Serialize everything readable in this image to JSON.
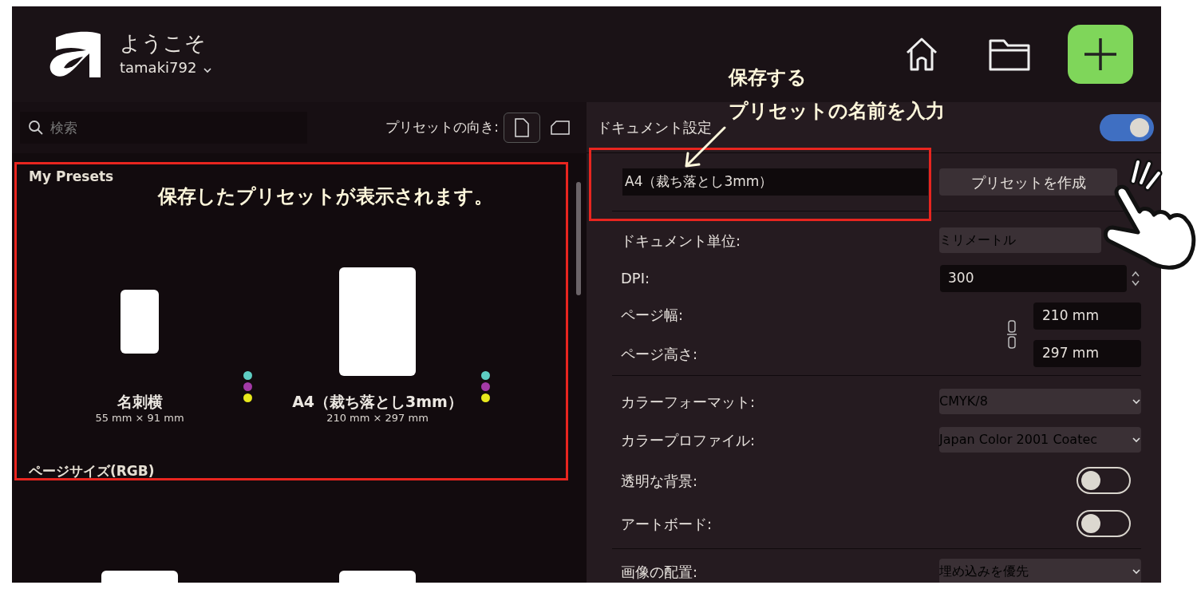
{
  "header": {
    "greeting": "ようこそ",
    "username": "tamaki792"
  },
  "left_panel": {
    "search": {
      "placeholder": "検索"
    },
    "orientation_label": "プリセットの向き:",
    "orientation_buttons": [
      {
        "kind": "portrait",
        "selected": true
      },
      {
        "kind": "landscape",
        "selected": false
      }
    ],
    "sections": [
      {
        "title": "My Presets",
        "presets": [
          {
            "kind": "small",
            "name": "名刺横",
            "size": "55 mm × 91 mm",
            "inks": [
              {
                "color": "#5ecdc2"
              },
              {
                "color": "#a33aa6"
              },
              {
                "color": "#e8e81c"
              }
            ]
          },
          {
            "kind": "large",
            "name": "A4（裁ち落とし3mm）",
            "size": "210 mm × 297 mm",
            "inks": [
              {
                "color": "#5ecdc2"
              },
              {
                "color": "#a33aa6"
              },
              {
                "color": "#e8e81c"
              }
            ]
          }
        ]
      },
      {
        "title": "ページサイズ(RGB)",
        "presets": [
          {
            "kind": "large"
          },
          {
            "kind": "large"
          }
        ]
      }
    ]
  },
  "right_panel": {
    "title": "ドキュメント設定",
    "toggle_on": true,
    "preset_name": {
      "value": "A4（裁ち落とし3mm）"
    },
    "create_button": "プリセットを作成",
    "groups": [
      {
        "rows": [
          {
            "kind": "select",
            "label": "ドキュメント単位:",
            "value": "ミリメートル",
            "chevron": false
          },
          {
            "kind": "number",
            "label": "DPI:",
            "value": "300"
          },
          {
            "kind": "dimensions",
            "width_label": "ページ幅:",
            "width_value": "210 mm",
            "height_label": "ページ高さ:",
            "height_value": "297 mm"
          }
        ]
      },
      {
        "rows": [
          {
            "kind": "select",
            "label": "カラーフォーマット:",
            "value": "CMYK/8",
            "chevron": true
          },
          {
            "kind": "select",
            "label": "カラープロファイル:",
            "value": "Japan Color 2001 Coatec",
            "chevron": true
          },
          {
            "kind": "toggle",
            "label": "透明な背景:",
            "on": false
          },
          {
            "kind": "toggle",
            "label": "アートボード:",
            "on": false
          }
        ]
      },
      {
        "rows": [
          {
            "kind": "select",
            "label": "画像の配置:",
            "value": "埋め込みを優先",
            "chevron": true
          }
        ]
      }
    ]
  },
  "annotations": {
    "presets_note": "保存したプリセットが表示されます。",
    "name_note": [
      "保存する",
      "プリセットの名前を入力"
    ]
  }
}
